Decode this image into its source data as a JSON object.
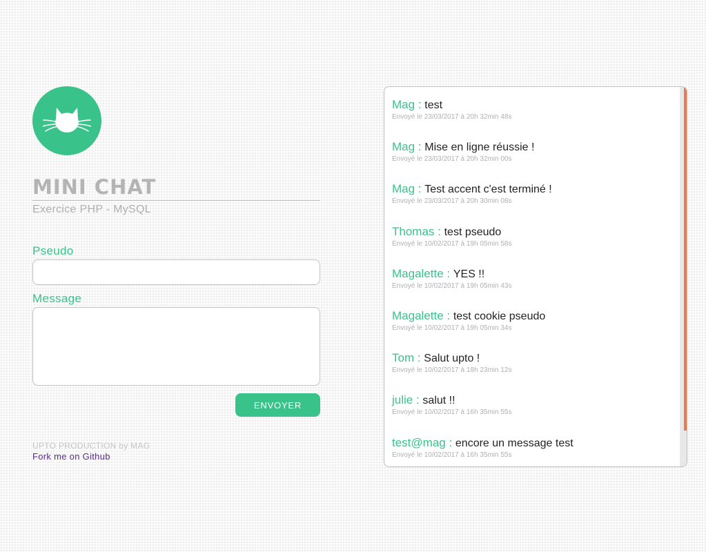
{
  "app": {
    "title": "MINI CHAT",
    "subtitle": "Exercice PHP - MySQL"
  },
  "form": {
    "pseudo_label": "Pseudo",
    "pseudo_value": "",
    "message_label": "Message",
    "message_value": "",
    "send_label": "ENVOYER"
  },
  "footer": {
    "credit": "UPTO PRODUCTION by MAG",
    "github_link": "Fork me on Github"
  },
  "colors": {
    "accent": "#3ac28b",
    "link": "#5a2a8c",
    "scrollbar": "#e27d55"
  },
  "icons": {
    "logo": "cat-icon"
  },
  "messages": [
    {
      "author": "Mag",
      "sep": " : ",
      "text": "test",
      "date": "Envoyé le 23/03/2017 à 20h 32min 48s"
    },
    {
      "author": "Mag",
      "sep": " : ",
      "text": "Mise en ligne réussie !",
      "date": "Envoyé le 23/03/2017 à 20h 32min 00s"
    },
    {
      "author": "Mag",
      "sep": " : ",
      "text": "Test accent c'est terminé !",
      "date": "Envoyé le 23/03/2017 à 20h 30min 08s"
    },
    {
      "author": "Thomas",
      "sep": " : ",
      "text": "test pseudo",
      "date": "Envoyé le 10/02/2017 à 19h 05min 58s"
    },
    {
      "author": "Magalette",
      "sep": " : ",
      "text": "YES !!",
      "date": "Envoyé le 10/02/2017 à 19h 05min 43s"
    },
    {
      "author": "Magalette",
      "sep": " : ",
      "text": "test cookie pseudo",
      "date": "Envoyé le 10/02/2017 à 19h 05min 34s"
    },
    {
      "author": "Tom",
      "sep": " : ",
      "text": "Salut upto !",
      "date": "Envoyé le 10/02/2017 à 18h 23min 12s"
    },
    {
      "author": "julie",
      "sep": " : ",
      "text": "salut !!",
      "date": "Envoyé le 10/02/2017 à 16h 35min 55s"
    },
    {
      "author": "test@mag",
      "sep": " : ",
      "text": "encore un message test",
      "date": "Envoyé le 10/02/2017 à 16h 35min 55s"
    }
  ]
}
